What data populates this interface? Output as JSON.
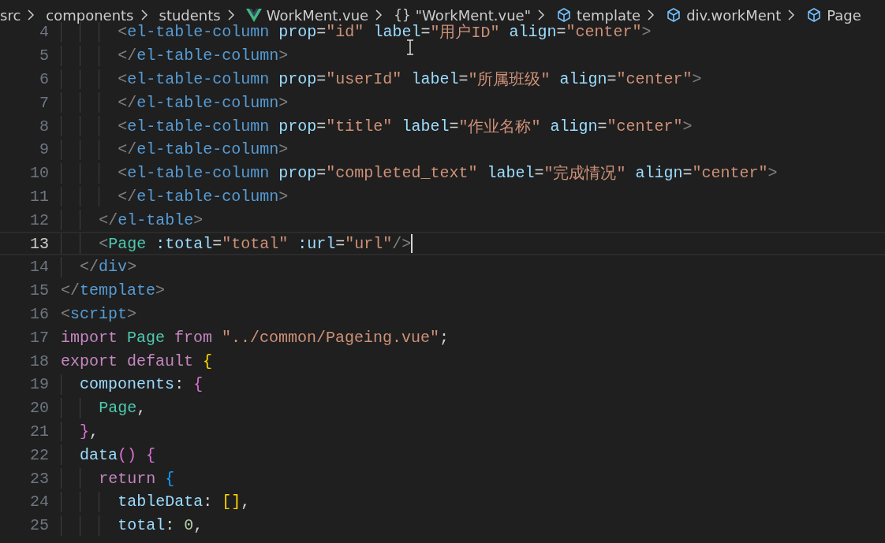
{
  "breadcrumb": [
    {
      "kind": "folder",
      "label": "src"
    },
    {
      "kind": "folder",
      "label": "components"
    },
    {
      "kind": "folder",
      "label": "students"
    },
    {
      "kind": "vue",
      "label": "WorkMent.vue"
    },
    {
      "kind": "braces",
      "glyph": "{}",
      "label": "\"WorkMent.vue\""
    },
    {
      "kind": "element",
      "label": "template"
    },
    {
      "kind": "element",
      "label": "div.workMent"
    },
    {
      "kind": "element",
      "label": "Page"
    }
  ],
  "editor": {
    "lines": [
      {
        "number": "4",
        "selected": false,
        "tokens": [
          {
            "kind": "punct",
            "text": "      <"
          },
          {
            "kind": "tag",
            "text": "el-table-column"
          },
          {
            "kind": "attr",
            "text": " prop"
          },
          {
            "kind": "op",
            "text": "="
          },
          {
            "kind": "string",
            "text": "\"id\""
          },
          {
            "kind": "attr",
            "text": " label"
          },
          {
            "kind": "op",
            "text": "="
          },
          {
            "kind": "string",
            "text": "\"用户ID\""
          },
          {
            "kind": "attr",
            "text": " align"
          },
          {
            "kind": "op",
            "text": "="
          },
          {
            "kind": "string",
            "text": "\"center\""
          },
          {
            "kind": "punct",
            "text": ">"
          }
        ]
      },
      {
        "number": "5",
        "selected": false,
        "tokens": [
          {
            "kind": "punct",
            "text": "      </"
          },
          {
            "kind": "tag",
            "text": "el-table-column"
          },
          {
            "kind": "punct",
            "text": ">"
          }
        ]
      },
      {
        "number": "6",
        "selected": false,
        "tokens": [
          {
            "kind": "punct",
            "text": "      <"
          },
          {
            "kind": "tag",
            "text": "el-table-column"
          },
          {
            "kind": "attr",
            "text": " prop"
          },
          {
            "kind": "op",
            "text": "="
          },
          {
            "kind": "string",
            "text": "\"userId\""
          },
          {
            "kind": "attr",
            "text": " label"
          },
          {
            "kind": "op",
            "text": "="
          },
          {
            "kind": "string",
            "text": "\"所属班级\""
          },
          {
            "kind": "attr",
            "text": " align"
          },
          {
            "kind": "op",
            "text": "="
          },
          {
            "kind": "string",
            "text": "\"center\""
          },
          {
            "kind": "punct",
            "text": ">"
          }
        ]
      },
      {
        "number": "7",
        "selected": false,
        "tokens": [
          {
            "kind": "punct",
            "text": "      </"
          },
          {
            "kind": "tag",
            "text": "el-table-column"
          },
          {
            "kind": "punct",
            "text": ">"
          }
        ]
      },
      {
        "number": "8",
        "selected": false,
        "tokens": [
          {
            "kind": "punct",
            "text": "      <"
          },
          {
            "kind": "tag",
            "text": "el-table-column"
          },
          {
            "kind": "attr",
            "text": " prop"
          },
          {
            "kind": "op",
            "text": "="
          },
          {
            "kind": "string",
            "text": "\"title\""
          },
          {
            "kind": "attr",
            "text": " label"
          },
          {
            "kind": "op",
            "text": "="
          },
          {
            "kind": "string",
            "text": "\"作业名称\""
          },
          {
            "kind": "attr",
            "text": " align"
          },
          {
            "kind": "op",
            "text": "="
          },
          {
            "kind": "string",
            "text": "\"center\""
          },
          {
            "kind": "punct",
            "text": ">"
          }
        ]
      },
      {
        "number": "9",
        "selected": false,
        "tokens": [
          {
            "kind": "punct",
            "text": "      </"
          },
          {
            "kind": "tag",
            "text": "el-table-column"
          },
          {
            "kind": "punct",
            "text": ">"
          }
        ]
      },
      {
        "number": "10",
        "selected": false,
        "tokens": [
          {
            "kind": "punct",
            "text": "      <"
          },
          {
            "kind": "tag",
            "text": "el-table-column"
          },
          {
            "kind": "attr",
            "text": " prop"
          },
          {
            "kind": "op",
            "text": "="
          },
          {
            "kind": "string",
            "text": "\"completed_text\""
          },
          {
            "kind": "attr",
            "text": " label"
          },
          {
            "kind": "op",
            "text": "="
          },
          {
            "kind": "string",
            "text": "\"完成情况\""
          },
          {
            "kind": "attr",
            "text": " align"
          },
          {
            "kind": "op",
            "text": "="
          },
          {
            "kind": "string",
            "text": "\"center\""
          },
          {
            "kind": "punct",
            "text": ">"
          }
        ]
      },
      {
        "number": "11",
        "selected": false,
        "tokens": [
          {
            "kind": "punct",
            "text": "      </"
          },
          {
            "kind": "tag",
            "text": "el-table-column"
          },
          {
            "kind": "punct",
            "text": ">"
          }
        ]
      },
      {
        "number": "12",
        "selected": false,
        "tokens": [
          {
            "kind": "punct",
            "text": "    </"
          },
          {
            "kind": "tag",
            "text": "el-table"
          },
          {
            "kind": "punct",
            "text": ">"
          }
        ]
      },
      {
        "number": "13",
        "selected": true,
        "tokens": [
          {
            "kind": "punct",
            "text": "    <"
          },
          {
            "kind": "component",
            "text": "Page"
          },
          {
            "kind": "attr",
            "text": " :total"
          },
          {
            "kind": "op",
            "text": "="
          },
          {
            "kind": "string",
            "text": "\"total\""
          },
          {
            "kind": "attr",
            "text": " :url"
          },
          {
            "kind": "op",
            "text": "="
          },
          {
            "kind": "string",
            "text": "\"url\""
          },
          {
            "kind": "punct",
            "text": "/>"
          }
        ]
      },
      {
        "number": "14",
        "selected": false,
        "tokens": [
          {
            "kind": "punct",
            "text": "  </"
          },
          {
            "kind": "tag",
            "text": "div"
          },
          {
            "kind": "punct",
            "text": ">"
          }
        ]
      },
      {
        "number": "15",
        "selected": false,
        "tokens": [
          {
            "kind": "punct",
            "text": "</"
          },
          {
            "kind": "tag",
            "text": "template"
          },
          {
            "kind": "punct",
            "text": ">"
          }
        ]
      },
      {
        "number": "16",
        "selected": false,
        "tokens": [
          {
            "kind": "punct",
            "text": "<"
          },
          {
            "kind": "tag",
            "text": "script"
          },
          {
            "kind": "punct",
            "text": ">"
          }
        ]
      },
      {
        "number": "17",
        "selected": false,
        "tokens": [
          {
            "kind": "keyword",
            "text": "import"
          },
          {
            "kind": "component",
            "text": " Page"
          },
          {
            "kind": "keyword",
            "text": " from"
          },
          {
            "kind": "string",
            "text": " \"../common/Pageing.vue\""
          },
          {
            "kind": "op",
            "text": ";"
          }
        ]
      },
      {
        "number": "18",
        "selected": false,
        "tokens": [
          {
            "kind": "keyword",
            "text": "export default"
          },
          {
            "kind": "bracket1",
            "text": " {"
          }
        ]
      },
      {
        "number": "19",
        "selected": false,
        "tokens": [
          {
            "kind": "attr",
            "text": "  components"
          },
          {
            "kind": "op",
            "text": ":"
          },
          {
            "kind": "bracket2",
            "text": " {"
          }
        ]
      },
      {
        "number": "20",
        "selected": false,
        "tokens": [
          {
            "kind": "component",
            "text": "    Page"
          },
          {
            "kind": "op",
            "text": ","
          }
        ]
      },
      {
        "number": "21",
        "selected": false,
        "tokens": [
          {
            "kind": "bracket2",
            "text": "  }"
          },
          {
            "kind": "op",
            "text": ","
          }
        ]
      },
      {
        "number": "22",
        "selected": false,
        "tokens": [
          {
            "kind": "attr",
            "text": "  data"
          },
          {
            "kind": "bracket2",
            "text": "() {"
          }
        ]
      },
      {
        "number": "23",
        "selected": false,
        "tokens": [
          {
            "kind": "keyword",
            "text": "    return"
          },
          {
            "kind": "bracket3",
            "text": " {"
          }
        ]
      },
      {
        "number": "24",
        "selected": false,
        "tokens": [
          {
            "kind": "attr",
            "text": "      tableData"
          },
          {
            "kind": "op",
            "text": ":"
          },
          {
            "kind": "bracket1",
            "text": " []"
          },
          {
            "kind": "op",
            "text": ","
          }
        ]
      },
      {
        "number": "25",
        "selected": false,
        "tokens": [
          {
            "kind": "attr",
            "text": "      total"
          },
          {
            "kind": "op",
            "text": ":"
          },
          {
            "kind": "number",
            "text": " 0"
          },
          {
            "kind": "op",
            "text": ","
          }
        ]
      }
    ]
  }
}
